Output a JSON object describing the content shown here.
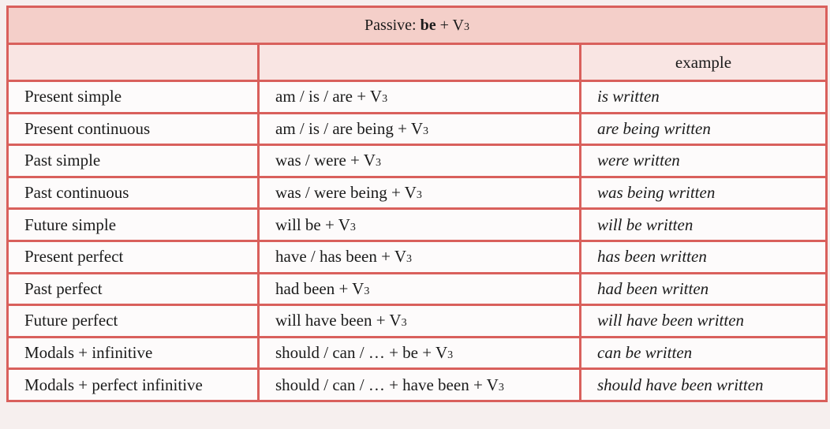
{
  "title": {
    "prefix": "Passive: ",
    "bold": "be",
    "middle": " + V",
    "sub": "3"
  },
  "header": {
    "col1": "",
    "col2": "",
    "col3": "example"
  },
  "rows": [
    {
      "tense": "Present simple",
      "form": "am / is / are + V",
      "sub": "3",
      "example": "is written"
    },
    {
      "tense": "Present continuous",
      "form": "am / is / are being + V",
      "sub": "3",
      "example": "are being written"
    },
    {
      "tense": "Past simple",
      "form": "was / were + V",
      "sub": "3",
      "example": "were written"
    },
    {
      "tense": "Past continuous",
      "form": "was / were being + V",
      "sub": "3",
      "example": "was being written"
    },
    {
      "tense": "Future simple",
      "form": "will be + V",
      "sub": "3",
      "example": "will be written"
    },
    {
      "tense": "Present perfect",
      "form": "have / has been + V",
      "sub": "3",
      "example": "has been written"
    },
    {
      "tense": "Past perfect",
      "form": "had been + V",
      "sub": "3",
      "example": "had been written"
    },
    {
      "tense": "Future perfect",
      "form": "will have been + V",
      "sub": "3",
      "example": "will have been written"
    },
    {
      "tense": "Modals + infinitive",
      "form": "should / can / … + be + V",
      "sub": "3",
      "example": "can be written"
    },
    {
      "tense": "Modals + perfect infinitive",
      "form": "should / can / … + have been + V",
      "sub": "3",
      "example": "should have been written"
    }
  ],
  "colors": {
    "border": "#d9605c",
    "title_bg": "#f4cfc9",
    "header_bg": "#f9e5e3",
    "row_bg": "#fdfbfb"
  }
}
